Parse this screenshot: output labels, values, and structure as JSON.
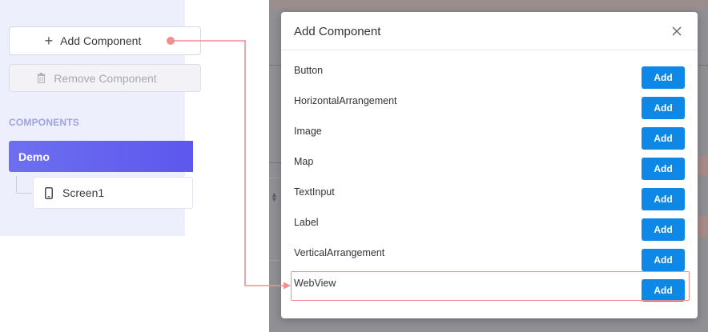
{
  "sidebar": {
    "add_component_label": "Add Component",
    "remove_component_label": "Remove Component",
    "components_heading": "COMPONENTS",
    "tree": {
      "root_label": "Demo",
      "child_label": "Screen1"
    }
  },
  "modal": {
    "title": "Add Component",
    "close_icon": "close-icon",
    "items": [
      {
        "name": "Button",
        "add_label": "Add"
      },
      {
        "name": "HorizontalArrangement",
        "add_label": "Add"
      },
      {
        "name": "Image",
        "add_label": "Add"
      },
      {
        "name": "Map",
        "add_label": "Add"
      },
      {
        "name": "TextInput",
        "add_label": "Add"
      },
      {
        "name": "Label",
        "add_label": "Add"
      },
      {
        "name": "VerticalArrangement",
        "add_label": "Add"
      },
      {
        "name": "WebView",
        "add_label": "Add",
        "highlighted": true
      }
    ]
  },
  "colors": {
    "accent": "#0e88e6",
    "sidebar_active": "#6366f1",
    "annotation": "#f0908e",
    "components_heading": "#9da3df"
  }
}
